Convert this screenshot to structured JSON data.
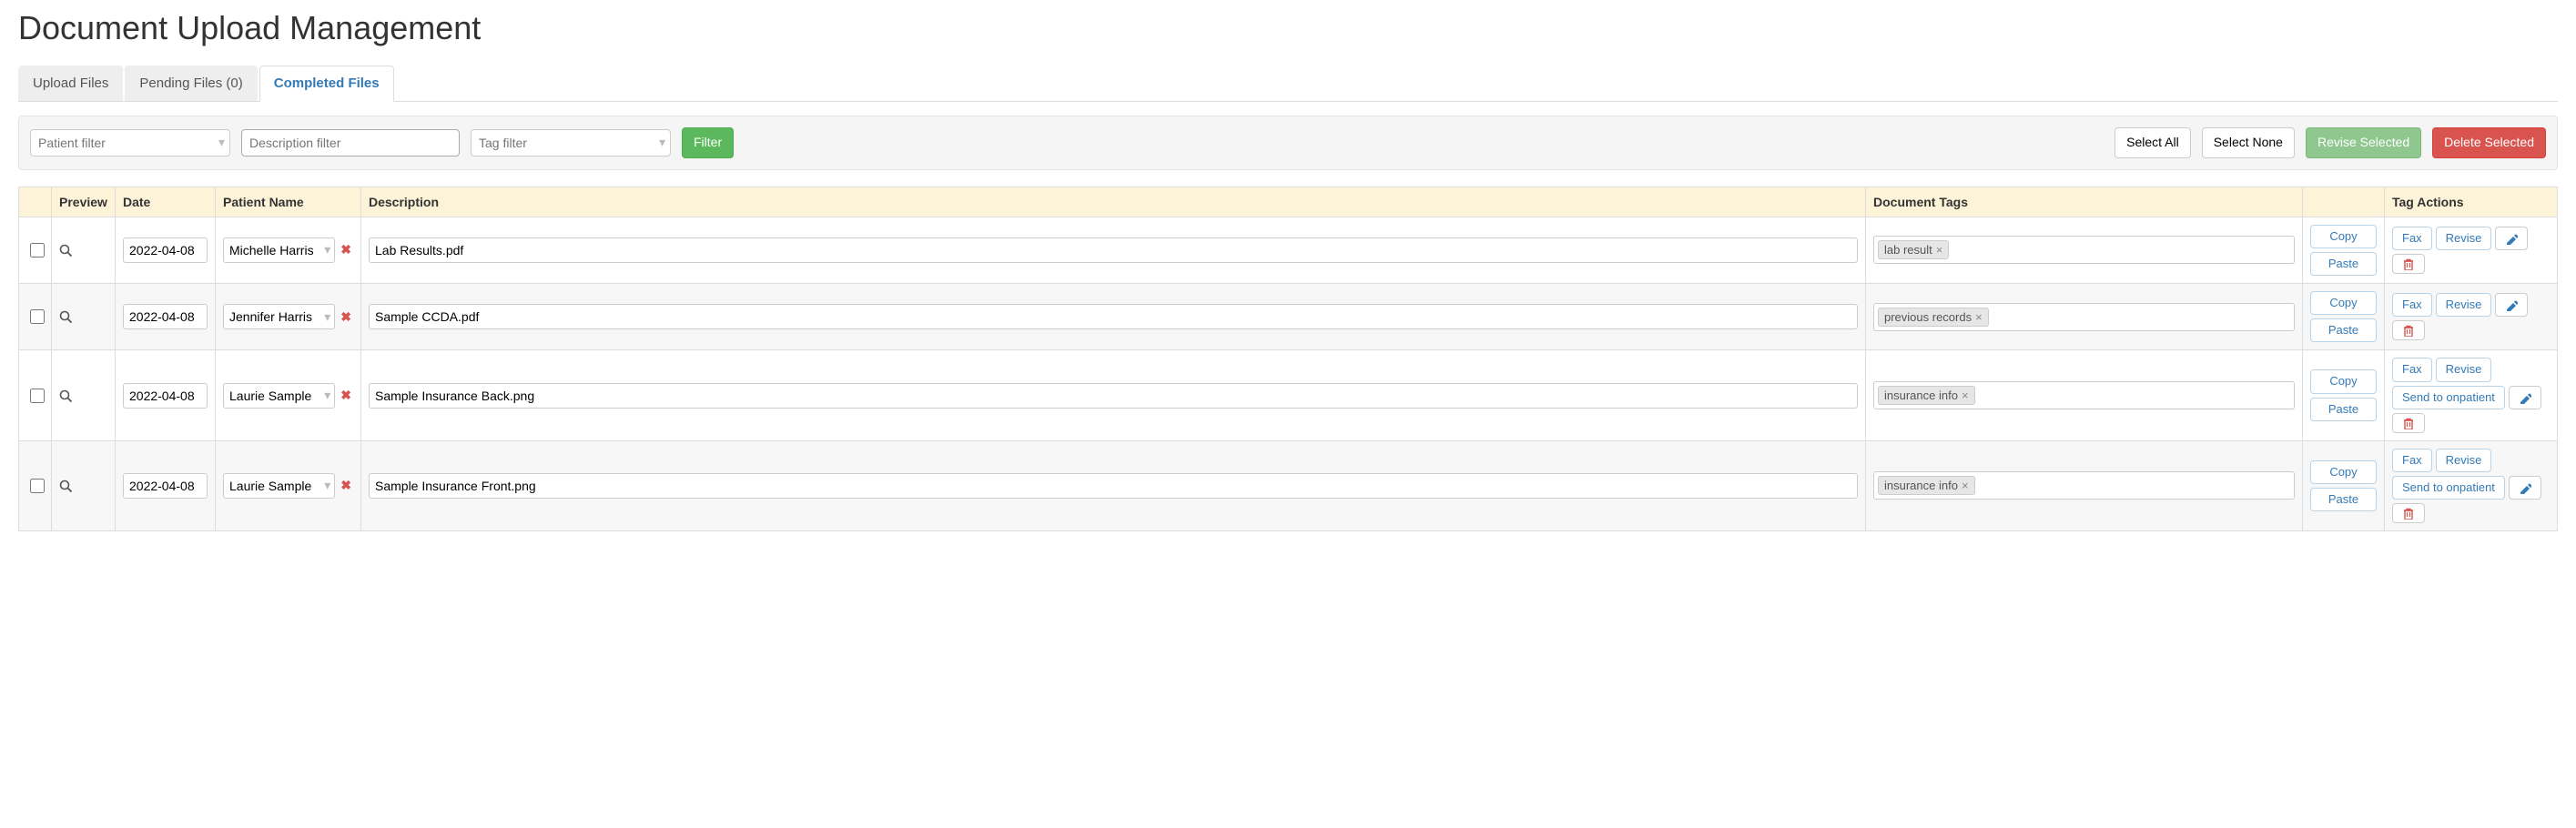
{
  "page_title": "Document Upload Management",
  "tabs": [
    {
      "label": "Upload Files",
      "active": false
    },
    {
      "label": "Pending Files (0)",
      "active": false
    },
    {
      "label": "Completed Files",
      "active": true
    }
  ],
  "filters": {
    "patient_placeholder": "Patient filter",
    "description_placeholder": "Description filter",
    "tag_placeholder": "Tag filter",
    "filter_button": "Filter",
    "select_all": "Select All",
    "select_none": "Select None",
    "revise_selected": "Revise Selected",
    "delete_selected": "Delete Selected"
  },
  "columns": {
    "checkbox": "",
    "preview": "Preview",
    "date": "Date",
    "patient": "Patient Name",
    "description": "Description",
    "tags": "Document Tags",
    "copy": "",
    "actions": "Tag Actions"
  },
  "button_labels": {
    "copy": "Copy",
    "paste": "Paste",
    "fax": "Fax",
    "revise": "Revise",
    "send_to_onpatient": "Send to onpatient"
  },
  "rows": [
    {
      "date": "2022-04-08",
      "patient": "Michelle Harris",
      "description": "Lab Results.pdf",
      "tags": [
        "lab result"
      ],
      "send_to_onpatient": false
    },
    {
      "date": "2022-04-08",
      "patient": "Jennifer Harris",
      "description": "Sample CCDA.pdf",
      "tags": [
        "previous records"
      ],
      "send_to_onpatient": false
    },
    {
      "date": "2022-04-08",
      "patient": "Laurie Sample",
      "description": "Sample Insurance Back.png",
      "tags": [
        "insurance info"
      ],
      "send_to_onpatient": true
    },
    {
      "date": "2022-04-08",
      "patient": "Laurie Sample",
      "description": "Sample Insurance Front.png",
      "tags": [
        "insurance info"
      ],
      "send_to_onpatient": true
    }
  ]
}
